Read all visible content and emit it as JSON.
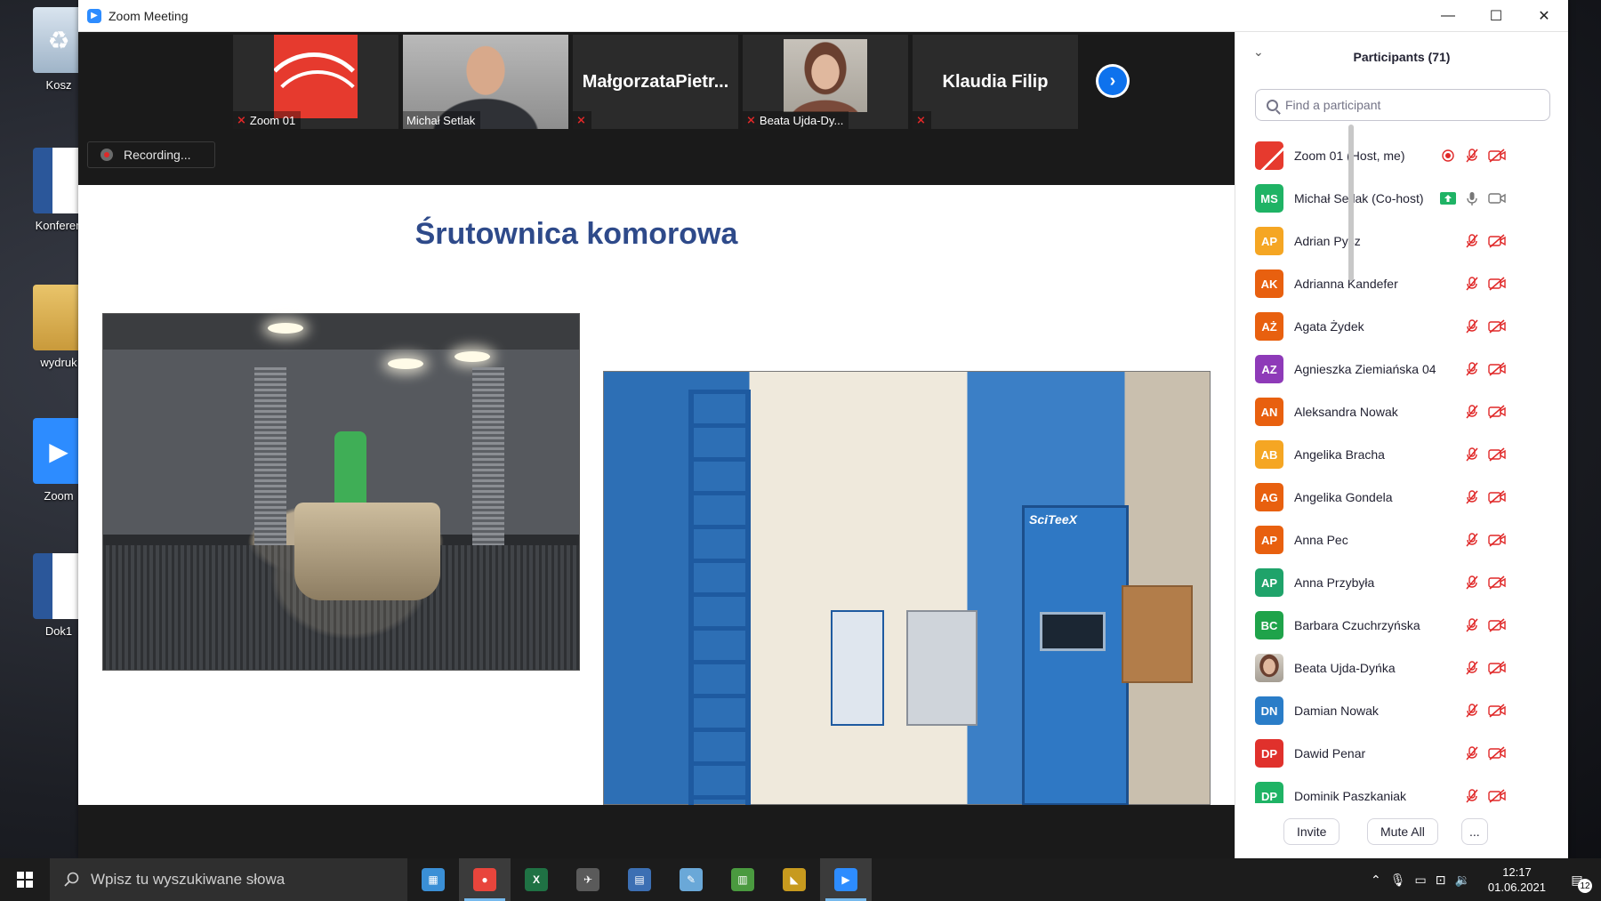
{
  "desktop": {
    "icons": [
      {
        "label": "Kosz"
      },
      {
        "label": "Konferen"
      },
      {
        "label": "wydruk"
      },
      {
        "label": "Zoom"
      },
      {
        "label": "Dok1"
      }
    ]
  },
  "window": {
    "title": "Zoom Meeting",
    "controls": {
      "minimize": "—",
      "maximize": "☐",
      "close": "✕"
    }
  },
  "video_strip": {
    "thumbnails": [
      {
        "name": "Zoom 01",
        "type": "logo",
        "muted": true
      },
      {
        "name": "Michał Setlak",
        "type": "video",
        "muted": false
      },
      {
        "name": "MałgorzataPietr...",
        "type": "name_only",
        "muted": true
      },
      {
        "name": "Beata Ujda-Dy...",
        "type": "photo",
        "muted": true
      },
      {
        "name": "Klaudia Filip",
        "type": "name_only",
        "muted": true
      }
    ],
    "next_label": "›",
    "recording_label": "Recording..."
  },
  "slide": {
    "title": "Śrutownica komorowa",
    "photo_right_brand": "SciTeeX"
  },
  "participants": {
    "title": "Participants (71)",
    "collapse_icon": "⌄",
    "search_placeholder": "Find a participant",
    "list": [
      {
        "initials": "",
        "name": "Zoom 01 (Host, me)",
        "color": "#e63a2e",
        "kind": "logo",
        "recording": true,
        "mic": "muted",
        "video": "off"
      },
      {
        "initials": "MS",
        "name": "Michał Setlak (Co-host)",
        "color": "#1fb365",
        "kind": "initials",
        "sharing": true,
        "mic": "on",
        "video": "on"
      },
      {
        "initials": "AP",
        "name": "Adrian Pysz",
        "color": "#f5a623",
        "kind": "initials",
        "mic": "muted",
        "video": "off"
      },
      {
        "initials": "AK",
        "name": "Adrianna Kandefer",
        "color": "#e8600f",
        "kind": "initials",
        "mic": "muted",
        "video": "off"
      },
      {
        "initials": "AŻ",
        "name": "Agata Żydek",
        "color": "#e8600f",
        "kind": "initials",
        "mic": "muted",
        "video": "off"
      },
      {
        "initials": "AZ",
        "name": "Agnieszka Ziemiańska 04",
        "color": "#8e3ab8",
        "kind": "initials",
        "mic": "muted",
        "video": "off"
      },
      {
        "initials": "AN",
        "name": "Aleksandra Nowak",
        "color": "#e8600f",
        "kind": "initials",
        "mic": "muted",
        "video": "off"
      },
      {
        "initials": "AB",
        "name": "Angelika Bracha",
        "color": "#f5a623",
        "kind": "initials",
        "mic": "muted",
        "video": "off"
      },
      {
        "initials": "AG",
        "name": "Angelika Gondela",
        "color": "#e8600f",
        "kind": "initials",
        "mic": "muted",
        "video": "off"
      },
      {
        "initials": "AP",
        "name": "Anna Pec",
        "color": "#e8600f",
        "kind": "initials",
        "mic": "muted",
        "video": "off"
      },
      {
        "initials": "AP",
        "name": "Anna Przybyła",
        "color": "#1fa36a",
        "kind": "initials",
        "mic": "muted",
        "video": "off"
      },
      {
        "initials": "BC",
        "name": "Barbara Czuchrzyńska",
        "color": "#1fa34a",
        "kind": "initials",
        "mic": "muted",
        "video": "off"
      },
      {
        "initials": "",
        "name": "Beata Ujda-Dyńka",
        "color": "#8a6a58",
        "kind": "photo",
        "mic": "muted",
        "video": "off"
      },
      {
        "initials": "DN",
        "name": "Damian Nowak",
        "color": "#2a7dc8",
        "kind": "initials",
        "mic": "muted",
        "video": "off"
      },
      {
        "initials": "DP",
        "name": "Dawid Penar",
        "color": "#e0312c",
        "kind": "initials",
        "mic": "muted",
        "video": "off"
      },
      {
        "initials": "DP",
        "name": "Dominik Paszkaniak",
        "color": "#1fb365",
        "kind": "initials",
        "mic": "muted",
        "video": "off"
      }
    ],
    "footer": {
      "invite": "Invite",
      "mute_all": "Mute All",
      "more": "..."
    }
  },
  "taskbar": {
    "search_text": "Wpisz tu wyszukiwane słowa",
    "apps": [
      {
        "name": "pc",
        "glyph": "▦",
        "color": "#3a8fd6"
      },
      {
        "name": "chrome",
        "glyph": "●",
        "color": "#e8453c"
      },
      {
        "name": "excel",
        "glyph": "X",
        "color": "#1f7244"
      },
      {
        "name": "eagle",
        "glyph": "✈",
        "color": "#5a5a5a"
      },
      {
        "name": "calculator",
        "glyph": "▤",
        "color": "#3c6fb3"
      },
      {
        "name": "paint",
        "glyph": "✎",
        "color": "#6aa8d8"
      },
      {
        "name": "sheets",
        "glyph": "▥",
        "color": "#4a9a3f"
      },
      {
        "name": "project",
        "glyph": "◣",
        "color": "#c79a1e"
      },
      {
        "name": "zoom",
        "glyph": "▶",
        "color": "#2d8cff"
      }
    ],
    "time": "12:17",
    "date": "01.06.2021",
    "notification_count": "12"
  }
}
